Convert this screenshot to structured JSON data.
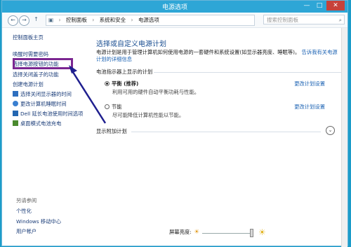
{
  "window": {
    "title": "电源选项",
    "min_label": "—",
    "max_label": "□",
    "close_label": "✕"
  },
  "addressbar": {
    "back": "←",
    "forward": "→",
    "up": "↑",
    "crumbs": [
      "控制面板",
      "系统和安全",
      "电源选项"
    ],
    "search_placeholder": "搜索控制面板"
  },
  "sidebar": {
    "home": "控制面板主页",
    "items": [
      "唤醒时需要密码",
      "选择电源按钮的功能",
      "选择关闭盖子的功能",
      "创建电源计划",
      "选择关闭显示器的时间",
      "更改计算机睡眠时间",
      "Dell 延长电池使用时间选项",
      "桌面模式电池充电"
    ],
    "see_also_title": "另请参阅",
    "see_also": [
      "个性化",
      "Windows 移动中心",
      "用户帐户"
    ]
  },
  "main": {
    "heading": "选择或自定义电源计划",
    "description": "电源计划是用于管理计算机如何使用电源的一套硬件和系统设置(如显示器亮度、睡眠等)。",
    "description_link": "告诉我有关电源计划的详细信息",
    "section_title": "电池指示器上显示的计划",
    "plans": [
      {
        "name": "平衡 (推荐)",
        "desc": "利用可用的硬件自动平衡功耗与性能。",
        "selected": true,
        "change": "更改计划设置"
      },
      {
        "name": "节能",
        "desc": "尽可能降低计算机性能以节能。",
        "selected": false,
        "change": "更改计划设置"
      }
    ],
    "extra_plans": "显示附加计划",
    "expander": "⌄"
  },
  "footer": {
    "brightness_label": "屏幕亮度:",
    "brightness_level": 1.0
  },
  "colors": {
    "highlight": "#7b2691",
    "arrow": "#1f1f8f",
    "link": "#1b62b3"
  }
}
